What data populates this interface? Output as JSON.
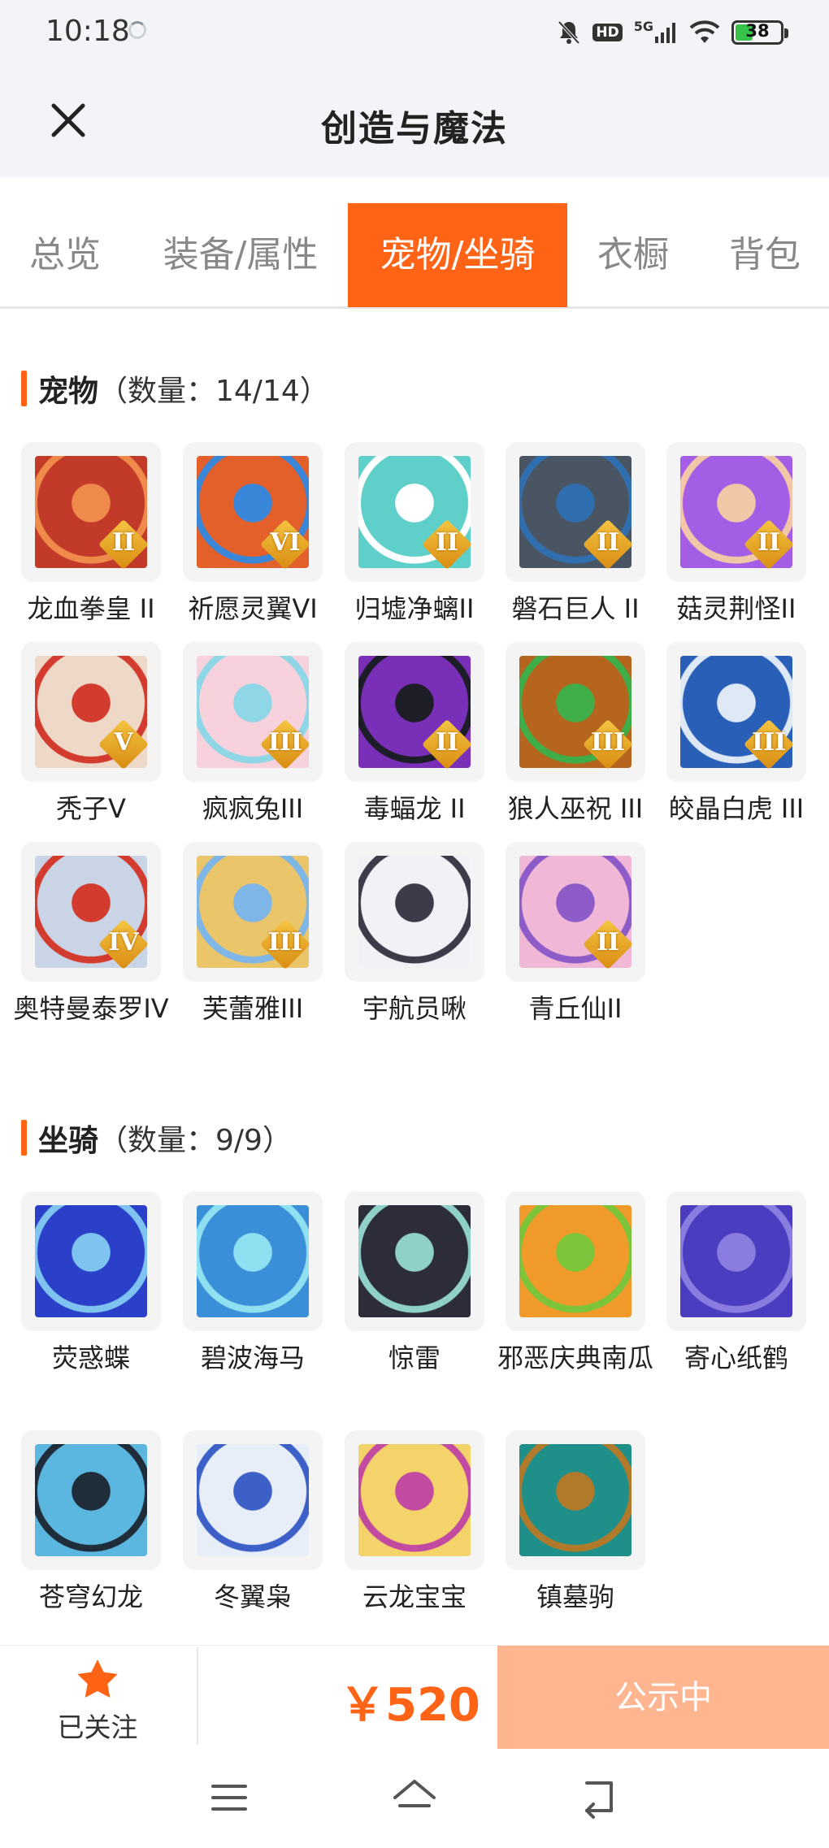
{
  "status_bar": {
    "time": "10:18",
    "hd": "HD",
    "network": "5G",
    "battery": "38",
    "battery_level": 0.38
  },
  "header": {
    "title": "创造与魔法"
  },
  "tabs": [
    {
      "label": "总览",
      "active": false
    },
    {
      "label": "装备/属性",
      "active": false
    },
    {
      "label": "宠物/坐骑",
      "active": true
    },
    {
      "label": "衣橱",
      "active": false
    },
    {
      "label": "背包",
      "active": false
    }
  ],
  "pets": {
    "title": "宠物",
    "count": "（数量：14/14）",
    "items": [
      {
        "name": "龙血拳皇 II",
        "rank": "II",
        "colors": [
          "#c23a2a",
          "#f08a4b"
        ]
      },
      {
        "name": "祈愿灵翼VI",
        "rank": "VI",
        "colors": [
          "#e4602a",
          "#3a86d8"
        ]
      },
      {
        "name": "归墟净螭II",
        "rank": "II",
        "colors": [
          "#5fd0c9",
          "#ffffff"
        ]
      },
      {
        "name": "磐石巨人 II",
        "rank": "II",
        "colors": [
          "#4a5563",
          "#2f6fb0"
        ]
      },
      {
        "name": "菇灵荆怪II",
        "rank": "II",
        "colors": [
          "#a45ee5",
          "#f2c7a8"
        ]
      },
      {
        "name": "秃子V",
        "rank": "V",
        "colors": [
          "#eed8c8",
          "#d23b2e"
        ]
      },
      {
        "name": "疯疯兔III",
        "rank": "III",
        "colors": [
          "#f7d2dd",
          "#8fd6e6"
        ]
      },
      {
        "name": "毒蝠龙 II",
        "rank": "II",
        "colors": [
          "#7a2fb8",
          "#1d1d28"
        ]
      },
      {
        "name": "狼人巫祝 III",
        "rank": "III",
        "colors": [
          "#b5651d",
          "#3fae49"
        ]
      },
      {
        "name": "皎晶白虎 III",
        "rank": "III",
        "colors": [
          "#2a5fb8",
          "#dfe9f5"
        ]
      },
      {
        "name": "奥特曼泰罗IV",
        "rank": "IV",
        "colors": [
          "#c9d5e6",
          "#d23b2e"
        ]
      },
      {
        "name": "芙蕾雅III",
        "rank": "III",
        "colors": [
          "#eac56a",
          "#7fb6e8"
        ]
      },
      {
        "name": "宇航员啾",
        "rank": "",
        "colors": [
          "#f2f2f6",
          "#3b3b4a"
        ]
      },
      {
        "name": "青丘仙II",
        "rank": "II",
        "colors": [
          "#f0b7d6",
          "#8e5cc9"
        ]
      }
    ]
  },
  "mounts": {
    "title": "坐骑",
    "count": "（数量：9/9）",
    "items": [
      {
        "name": "荧惑蝶",
        "rank": "",
        "colors": [
          "#2a40c8",
          "#7fc4f0"
        ]
      },
      {
        "name": "碧波海马",
        "rank": "",
        "colors": [
          "#3b8fd8",
          "#8fe0f0"
        ]
      },
      {
        "name": "惊雷",
        "rank": "",
        "colors": [
          "#2d2d3a",
          "#8fd1c9"
        ]
      },
      {
        "name": "邪恶庆典南瓜",
        "rank": "",
        "colors": [
          "#f09a2a",
          "#7cc43a"
        ]
      },
      {
        "name": "寄心纸鹤",
        "rank": "",
        "colors": [
          "#4b3dc0",
          "#8a7de0"
        ]
      },
      {
        "name": "苍穹幻龙",
        "rank": "",
        "colors": [
          "#5cb7e0",
          "#1f2c3a"
        ]
      },
      {
        "name": "冬翼枭",
        "rank": "",
        "colors": [
          "#e8eef8",
          "#3c5fc8"
        ]
      },
      {
        "name": "云龙宝宝",
        "rank": "",
        "colors": [
          "#f4d46a",
          "#c24aa0"
        ]
      },
      {
        "name": "镇墓驹",
        "rank": "",
        "colors": [
          "#1f8f8a",
          "#b07a2a"
        ]
      }
    ]
  },
  "bottom_bar": {
    "follow_label": "已关注",
    "price": "￥520",
    "status_label": "公示中",
    "accent_color": "#ff6316"
  }
}
